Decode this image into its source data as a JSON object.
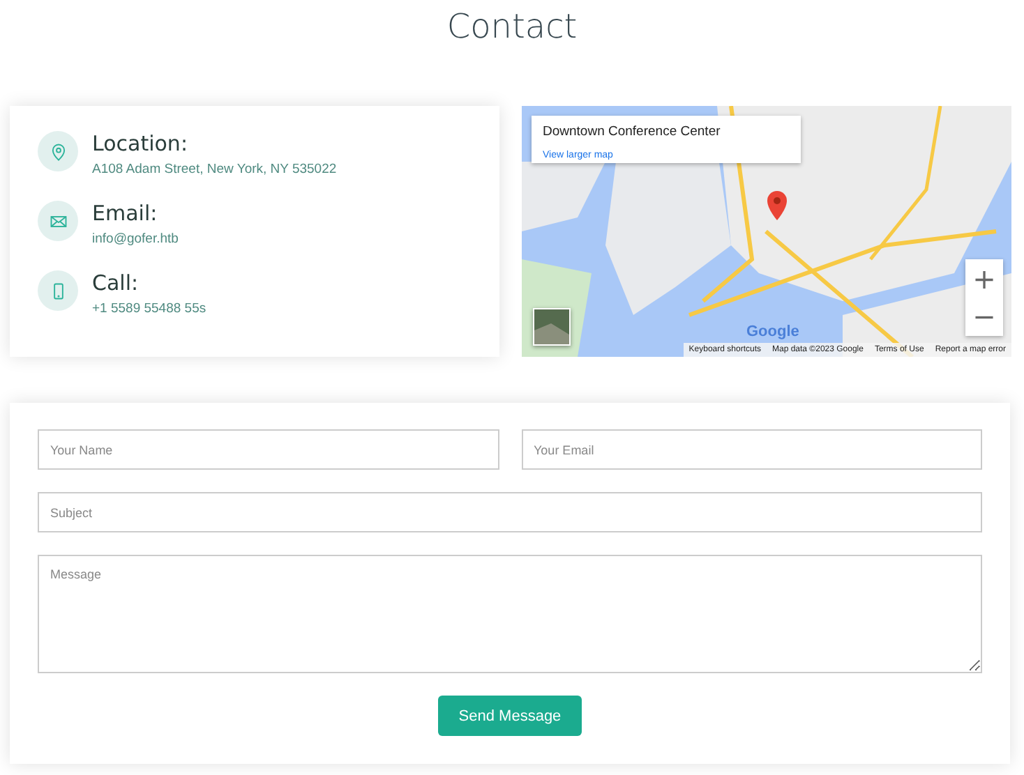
{
  "title": "Contact",
  "info": [
    {
      "kind": "location",
      "label": "Location:",
      "value": "A108 Adam Street, New York, NY 535022"
    },
    {
      "kind": "email",
      "label": "Email:",
      "value": "info@gofer.htb"
    },
    {
      "kind": "call",
      "label": "Call:",
      "value": "+1 5589 55488 55s"
    }
  ],
  "map": {
    "place": "Downtown Conference Center",
    "link": "View larger map",
    "zoom_in": "+",
    "zoom_out": "−",
    "brand": "Google",
    "footer": [
      "Keyboard shortcuts",
      "Map data ©2023 Google",
      "Terms of Use",
      "Report a map error"
    ]
  },
  "form": {
    "name": {
      "placeholder": "Your Name"
    },
    "email": {
      "placeholder": "Your Email"
    },
    "subject": {
      "placeholder": "Subject"
    },
    "message": {
      "placeholder": "Message"
    },
    "submit": "Send Message"
  }
}
